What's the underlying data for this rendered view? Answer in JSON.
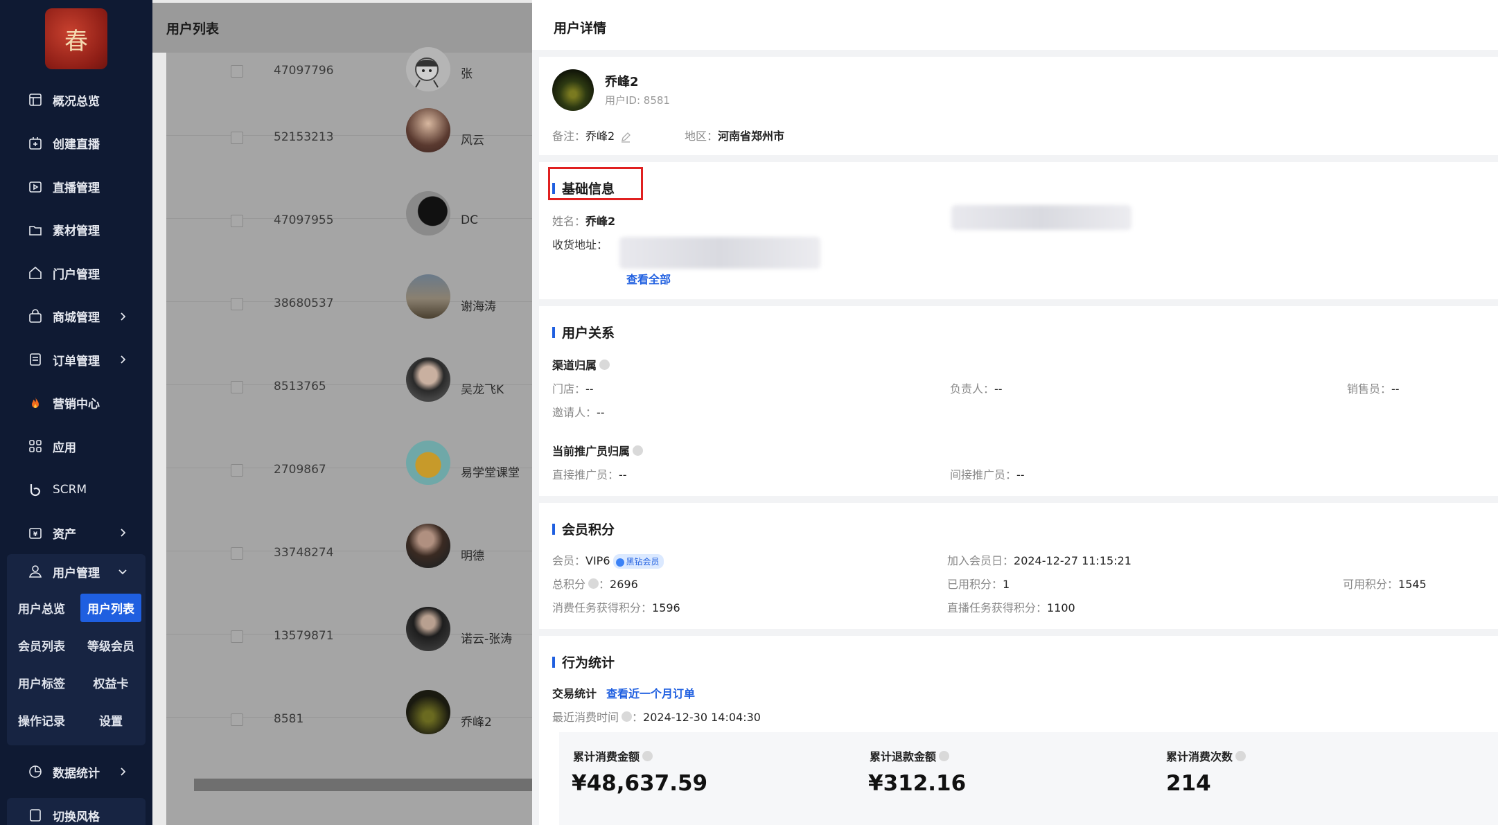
{
  "sidebar": {
    "logo_char": "春",
    "items": [
      {
        "label": "概况总览",
        "icon": "dashboard-icon"
      },
      {
        "label": "创建直播",
        "icon": "add-live-icon"
      },
      {
        "label": "直播管理",
        "icon": "live-icon"
      },
      {
        "label": "素材管理",
        "icon": "folder-icon"
      },
      {
        "label": "门户管理",
        "icon": "home-icon"
      },
      {
        "label": "商城管理",
        "icon": "shop-icon"
      },
      {
        "label": "订单管理",
        "icon": "order-icon"
      },
      {
        "label": "营销中心",
        "icon": "fire-icon"
      },
      {
        "label": "应用",
        "icon": "apps-icon"
      },
      {
        "label": "SCRM",
        "icon": "scrm-icon"
      },
      {
        "label": "资产",
        "icon": "asset-icon"
      }
    ],
    "user_mgmt": {
      "label": "用户管理",
      "sub": [
        "用户总览",
        "用户列表",
        "会员列表",
        "等级会员",
        "用户标签",
        "权益卡",
        "操作记录",
        "设置"
      ],
      "active": "用户列表"
    },
    "bottom": [
      {
        "label": "数据统计",
        "icon": "chart-icon"
      },
      {
        "label": "切换风格",
        "icon": "style-icon"
      }
    ]
  },
  "list": {
    "title": "用户列表",
    "rows": [
      {
        "id": "47097796",
        "name": "张"
      },
      {
        "id": "52153213",
        "name": "风云"
      },
      {
        "id": "47097955",
        "name": "DC"
      },
      {
        "id": "38680537",
        "name": "谢海涛"
      },
      {
        "id": "8513765",
        "name": "吴龙飞K"
      },
      {
        "id": "2709867",
        "name": "易学堂课堂"
      },
      {
        "id": "33748274",
        "name": "明德"
      },
      {
        "id": "13579871",
        "name": "诺云-张涛"
      },
      {
        "id": "8581",
        "name": "乔峰2"
      }
    ]
  },
  "detail": {
    "title": "用户详情",
    "user": {
      "name": "乔峰2",
      "id_label": "用户ID: 8581",
      "remark_label": "备注：",
      "remark": "乔峰2",
      "region_label": "地区：",
      "region": "河南省郑州市"
    },
    "basic": {
      "title": "基础信息",
      "name_label": "姓名：",
      "name": "乔峰2",
      "address_label": "收货地址：",
      "view_all": "查看全部"
    },
    "relation": {
      "title": "用户关系",
      "channel_title": "渠道归属",
      "store_label": "门店：",
      "store": "--",
      "owner_label": "负责人：",
      "owner": "--",
      "sales_label": "销售员：",
      "sales": "--",
      "inviter_label": "邀请人：",
      "inviter": "--",
      "promoter_title": "当前推广员归属",
      "direct_label": "直接推广员：",
      "direct": "--",
      "indirect_label": "间接推广员：",
      "indirect": "--"
    },
    "points": {
      "title": "会员积分",
      "member_label": "会员：",
      "member": "VIP6",
      "badge": "黑钻会员",
      "join_label": "加入会员日：",
      "join": "2024-12-27 11:15:21",
      "total_label": "总积分",
      "total": "2696",
      "used_label": "已用积分：",
      "used": "1",
      "available_label": "可用积分：",
      "available": "1545",
      "task_label": "消费任务获得积分：",
      "task": "1596",
      "live_label": "直播任务获得积分：",
      "live": "1100"
    },
    "behavior": {
      "title": "行为统计",
      "trade_label": "交易统计",
      "recent_link": "查看近一个月订单",
      "last_label": "最近消费时间",
      "last": "2024-12-30 14:04:30",
      "stats": [
        {
          "label": "累计消费金额",
          "value": "¥48,637.59"
        },
        {
          "label": "累计退款金额",
          "value": "¥312.16"
        },
        {
          "label": "累计消费次数",
          "value": "214"
        }
      ]
    }
  }
}
